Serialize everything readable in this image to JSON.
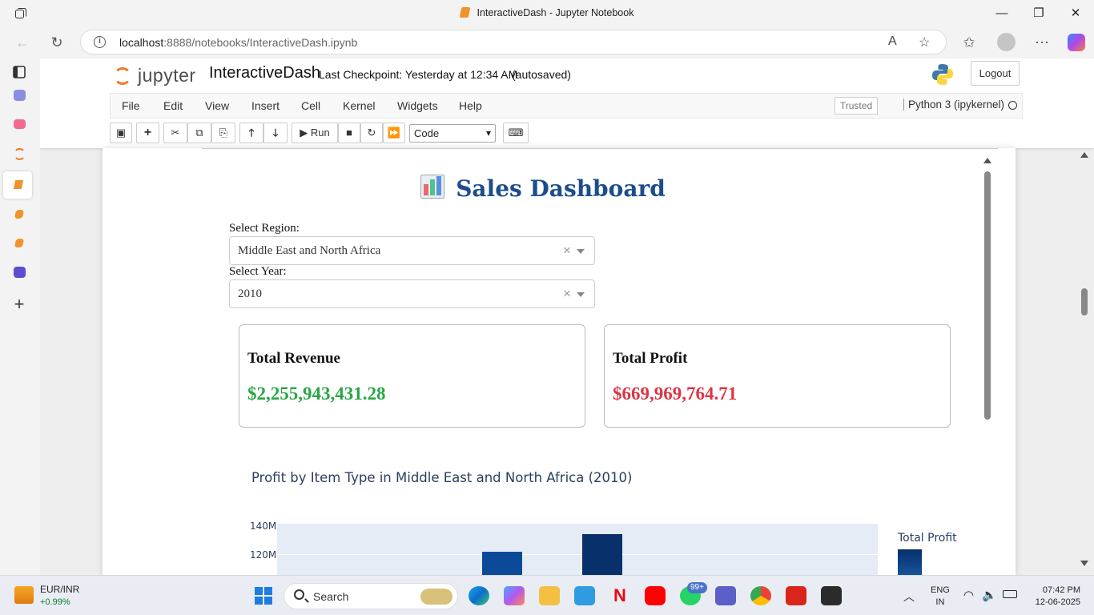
{
  "window": {
    "title": "InteractiveDash - Jupyter Notebook"
  },
  "browser": {
    "url_host": "localhost",
    "url_rest": ":8888/notebooks/InteractiveDash.ipynb"
  },
  "jupyter": {
    "logo_text": "jupyter",
    "notebook_name": "InteractiveDash",
    "checkpoint": "Last Checkpoint: Yesterday at 12:34 AM",
    "autosave": "(autosaved)",
    "logout": "Logout",
    "menu": [
      "File",
      "Edit",
      "View",
      "Insert",
      "Cell",
      "Kernel",
      "Widgets",
      "Help"
    ],
    "trusted": "Trusted",
    "kernel": "Python 3 (ipykernel)",
    "toolbar": {
      "run": "Run",
      "cell_type": "Code"
    }
  },
  "dashboard": {
    "title": "Sales Dashboard",
    "region_label": "Select Region:",
    "region_value": "Middle East and North Africa",
    "year_label": "Select Year:",
    "year_value": "2010",
    "clear_glyph": "×",
    "revenue_label": "Total Revenue",
    "revenue_value": "$2,255,943,431.28",
    "revenue_color": "#28a745",
    "profit_label": "Total Profit",
    "profit_value": "$669,969,764.71",
    "profit_color": "#dc3545"
  },
  "chart_data": {
    "type": "bar",
    "title": "Profit by Item Type in Middle East and North Africa (2010)",
    "yticks": [
      "140M",
      "120M"
    ],
    "legend_title": "Total Profit",
    "visible_bars": [
      {
        "value": 123000000,
        "color": "#0b4a99"
      },
      {
        "value": 135000000,
        "color": "#08306b"
      }
    ]
  },
  "taskbar": {
    "ticker_name": "EUR/INR",
    "ticker_change": "+0.99%",
    "search": "Search",
    "badge": "99+",
    "lang1": "ENG",
    "lang2": "IN",
    "time": "07:42 PM",
    "date": "12-06-2025"
  }
}
